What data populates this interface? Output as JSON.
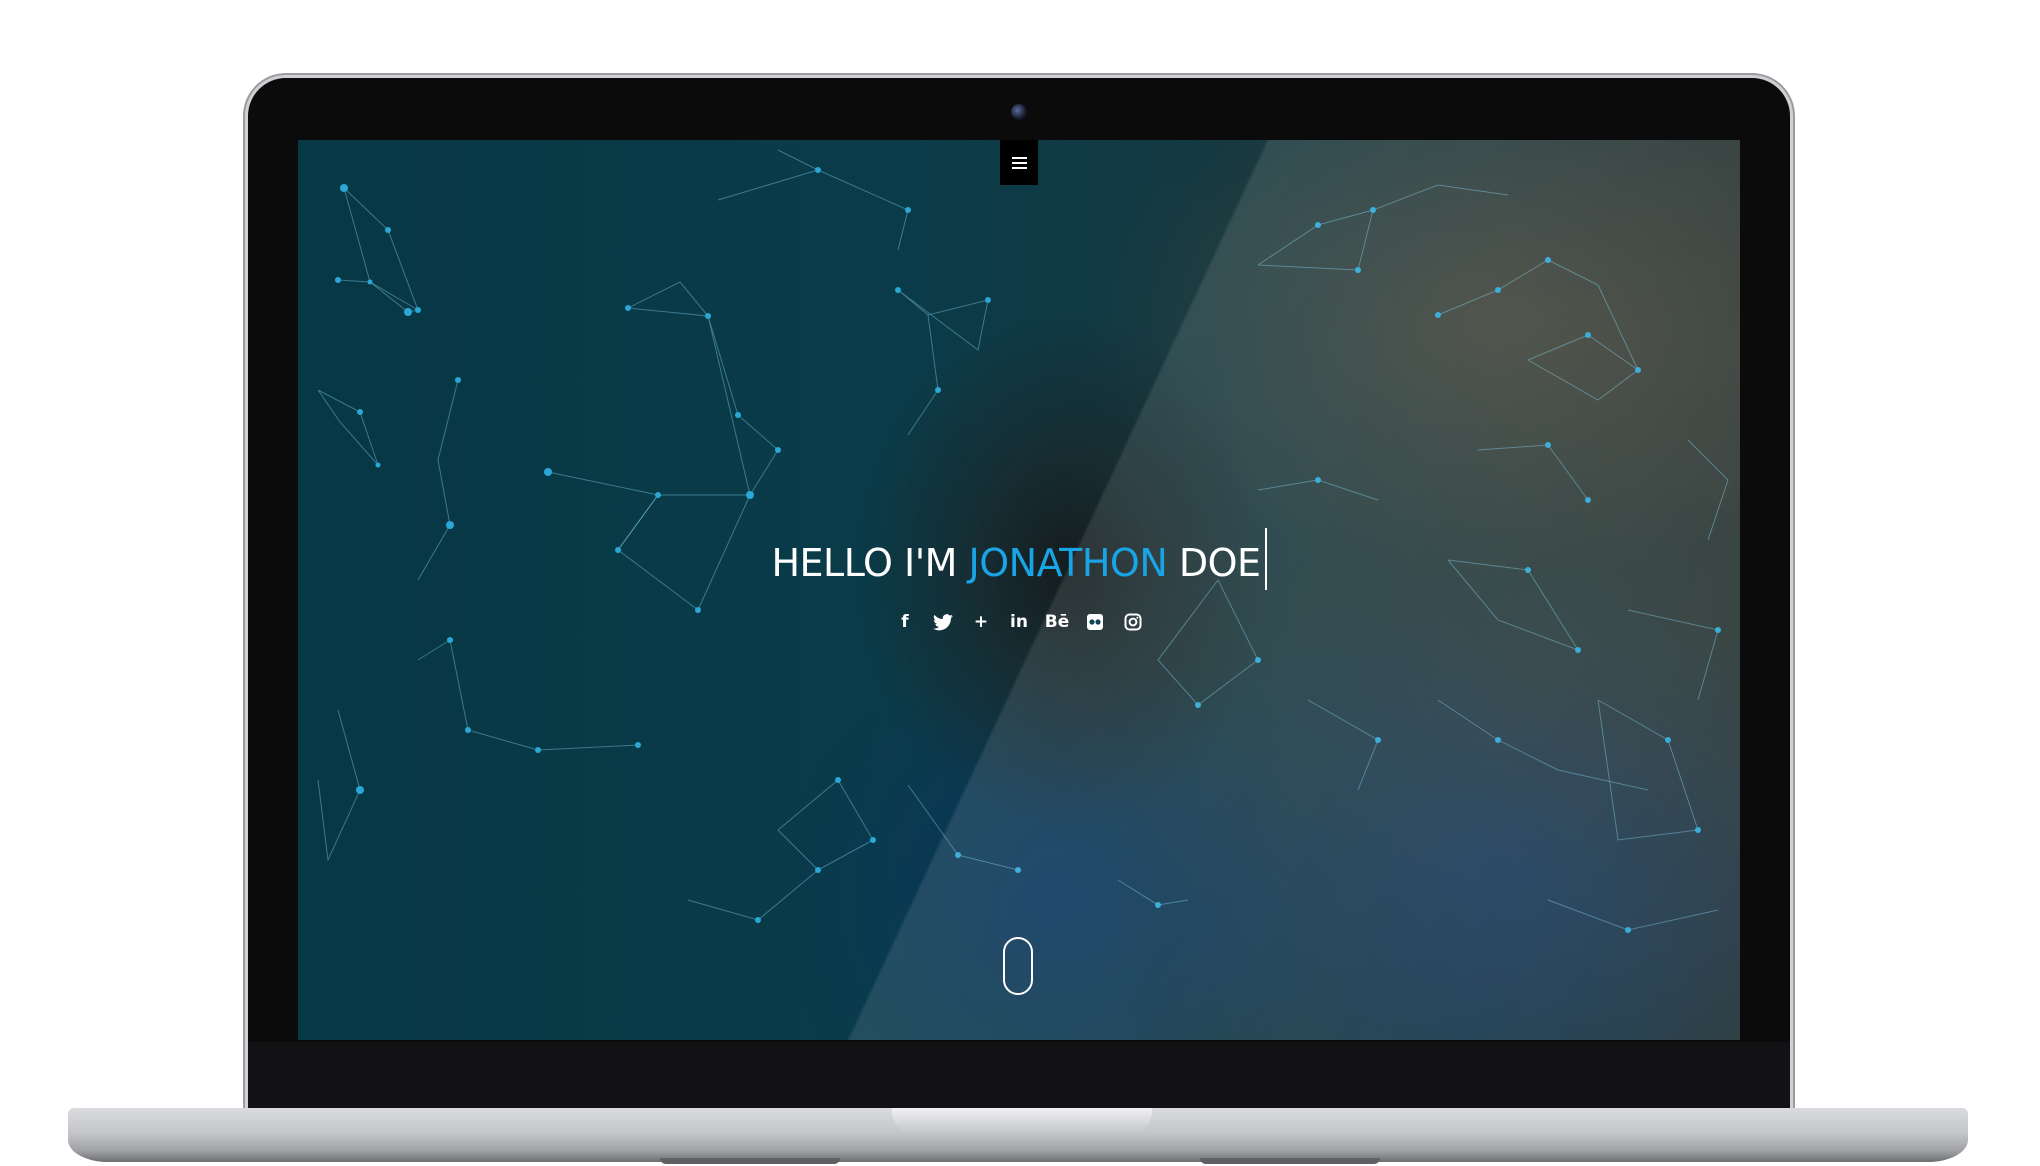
{
  "site": {
    "menu_icon": "hamburger-icon",
    "headline": {
      "prefix": "HELLO I'M ",
      "name": "JONATHON",
      "suffix": " DOE"
    },
    "accent_color": "#19a4e6",
    "socials": [
      {
        "icon": "facebook-icon",
        "glyph": "f"
      },
      {
        "icon": "twitter-icon",
        "glyph": ""
      },
      {
        "icon": "google-plus-icon",
        "glyph": "+"
      },
      {
        "icon": "linkedin-icon",
        "glyph": "in"
      },
      {
        "icon": "behance-icon",
        "glyph": "Bē"
      },
      {
        "icon": "flickr-icon",
        "glyph": ""
      },
      {
        "icon": "instagram-icon",
        "glyph": ""
      }
    ],
    "scroll_icon": "mouse-scroll-icon"
  }
}
